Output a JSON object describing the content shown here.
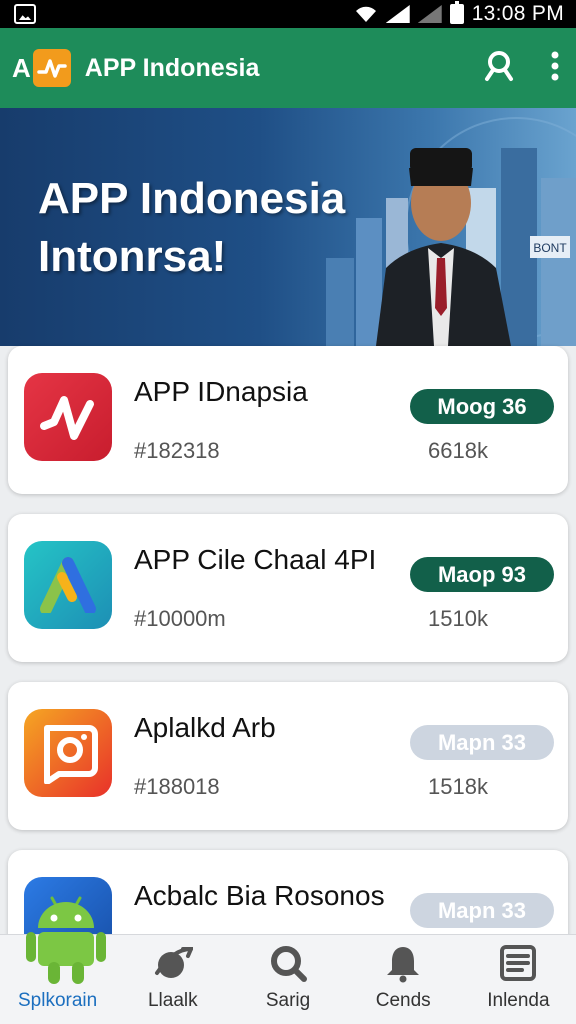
{
  "status_bar": {
    "time": "13:08 PM"
  },
  "app_bar": {
    "logo_letter": "A",
    "title": "APP Indonesia"
  },
  "banner": {
    "line1": "APP Indonesia",
    "line2": "Intonrsa!",
    "sign_text": "BONT"
  },
  "cards": [
    {
      "name": "APP IDnapsia",
      "code": "#182318",
      "pill": "Moog 36",
      "pill_style": "dark",
      "count": "6618k",
      "icon": "red-chart-app-icon"
    },
    {
      "name": "APP Cile Chaal 4PI",
      "code": "#10000m",
      "pill": "Maop 93",
      "pill_style": "dark",
      "count": "1510k",
      "icon": "colorful-a-app-icon"
    },
    {
      "name": "Aplalkd Arb",
      "code": "#188018",
      "pill": "Mapn 33",
      "pill_style": "light",
      "count": "1518k",
      "icon": "camera-chat-app-icon"
    },
    {
      "name": "Acbalc Bia Rosonos",
      "code": "",
      "pill": "Mapn 33",
      "pill_style": "light",
      "count": "",
      "icon": "blue-app-icon"
    }
  ],
  "bottom_nav": [
    {
      "label": "Splkorain",
      "icon": "android-icon",
      "active": true
    },
    {
      "label": "Llaalk",
      "icon": "globe-icon",
      "active": false
    },
    {
      "label": "Sarig",
      "icon": "search-icon",
      "active": false
    },
    {
      "label": "Cends",
      "icon": "bell-icon",
      "active": false
    },
    {
      "label": "Inlenda",
      "icon": "list-icon",
      "active": false
    }
  ],
  "colors": {
    "app_bar": "#1e8c5a",
    "pill_dark": "#12604a",
    "pill_light": "#cdd5e0",
    "active_nav": "#1c6fbf"
  }
}
